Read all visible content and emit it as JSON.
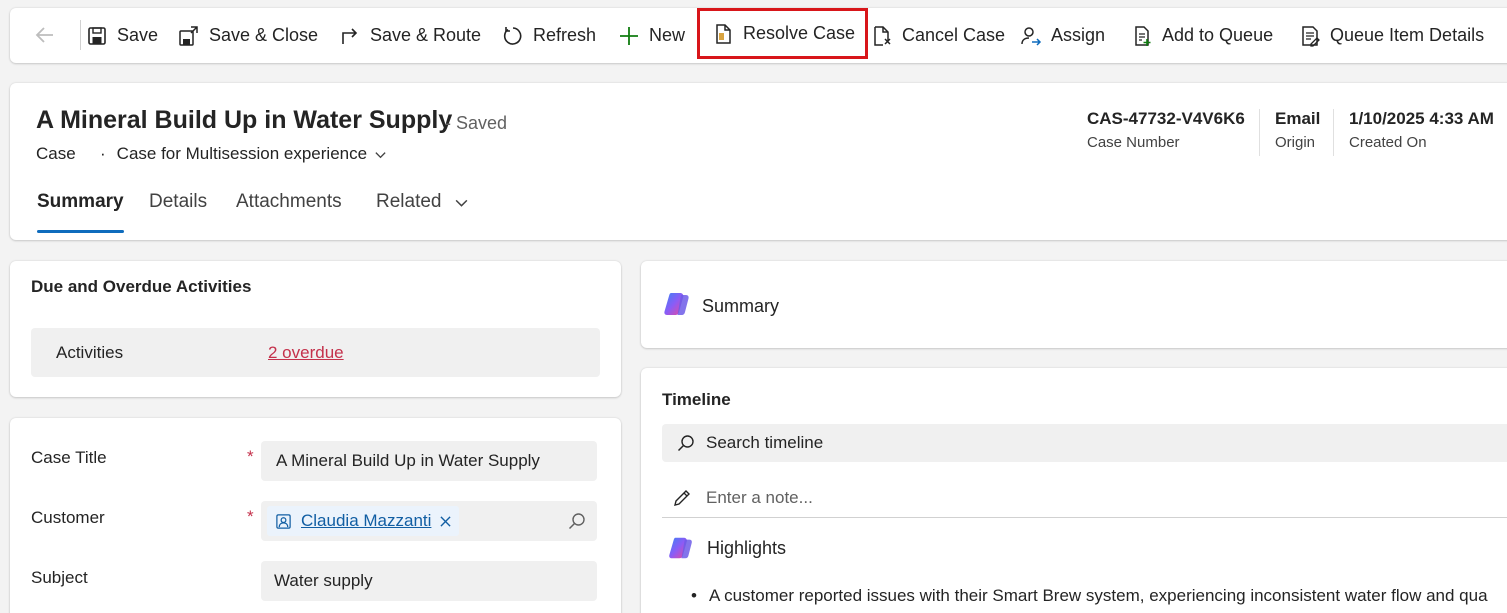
{
  "commandbar": {
    "back_icon": "arrow-left-icon",
    "items": [
      {
        "label": "Save",
        "icon": "save-icon"
      },
      {
        "label": "Save & Close",
        "icon": "save-close-icon"
      },
      {
        "label": "Save & Route",
        "icon": "route-icon"
      },
      {
        "label": "Refresh",
        "icon": "refresh-icon"
      },
      {
        "label": "New",
        "icon": "plus-icon"
      },
      {
        "label": "Resolve Case",
        "icon": "resolve-case-icon"
      },
      {
        "label": "Cancel Case",
        "icon": "cancel-case-icon"
      },
      {
        "label": "Assign",
        "icon": "assign-icon"
      },
      {
        "label": "Add to Queue",
        "icon": "add-queue-icon"
      },
      {
        "label": "Queue Item Details",
        "icon": "queue-details-icon"
      }
    ],
    "highlight_color": "#d8161a"
  },
  "header": {
    "title": "A Mineral Build Up in Water Supply",
    "saved_status": "- Saved",
    "entity": "Case",
    "separator": "·",
    "form_name": "Case for Multisession experience",
    "fields": [
      {
        "value": "CAS-47732-V4V6K6",
        "label": "Case Number"
      },
      {
        "value": "Email",
        "label": "Origin"
      },
      {
        "value": "1/10/2025 4:33 AM",
        "label": "Created On"
      }
    ],
    "tabs": [
      {
        "label": "Summary",
        "active": true
      },
      {
        "label": "Details"
      },
      {
        "label": "Attachments"
      },
      {
        "label": "Related"
      }
    ]
  },
  "activities": {
    "title": "Due and Overdue Activities",
    "row_label": "Activities",
    "row_value": "2 overdue"
  },
  "form": {
    "case_title_label": "Case Title",
    "case_title_value": "A Mineral Build Up in Water Supply",
    "customer_label": "Customer",
    "customer_value": "Claudia Mazzanti",
    "subject_label": "Subject",
    "subject_value": "Water supply",
    "required_marker": "*"
  },
  "summary_panel": {
    "label": "Summary"
  },
  "timeline": {
    "title": "Timeline",
    "search_placeholder": "Search timeline",
    "note_placeholder": "Enter a note...",
    "highlights_label": "Highlights",
    "bullet_text": "A customer reported issues with their Smart Brew system, experiencing inconsistent water flow and qua"
  },
  "colors": {
    "accent": "#0f6cbd",
    "overdue": "#c4314b",
    "link": "#115ea3"
  }
}
